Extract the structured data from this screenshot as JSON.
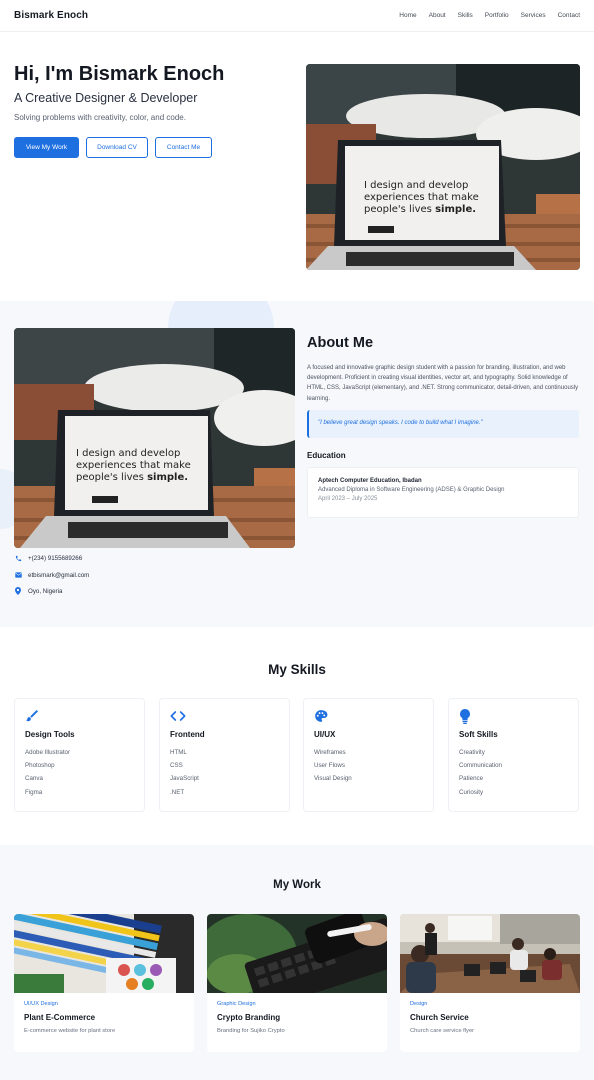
{
  "nav": {
    "brand": "Bismark Enoch",
    "links": [
      "Home",
      "About",
      "Skills",
      "Portfolio",
      "Services",
      "Contact"
    ]
  },
  "hero": {
    "title": "Hi, I'm Bismark Enoch",
    "subtitle": "A Creative Designer & Developer",
    "tagline": "Solving problems with creativity, color, and code.",
    "buttons": [
      "View My Work",
      "Download CV",
      "Contact Me"
    ],
    "laptop_screen_text": "I design and develop experiences that make people's lives",
    "laptop_screen_bold": "simple."
  },
  "about": {
    "title": "About Me",
    "body": "A focused and innovative graphic design student with a passion for branding, illustration, and web development. Proficient in creating visual identities, vector art, and typography. Solid knowledge of HTML, CSS, JavaScript (elementary), and .NET. Strong communicator, detail-driven, and continuously learning.",
    "quote": "\"I believe great design speaks. I code to build what I imagine.\"",
    "education_title": "Education",
    "education": {
      "school": "Aptech Computer Education, Ibadan",
      "program": "Advanced Diploma in Software Engineering (ADSE) & Graphic Design",
      "dates": "April 2023 – July 2025"
    },
    "contacts": [
      {
        "icon": "phone-icon",
        "text": "+(234) 9155689266"
      },
      {
        "icon": "email-icon",
        "text": "etbismark@gmail.com"
      },
      {
        "icon": "location-pin-icon",
        "text": "Oyo, Nigeria"
      }
    ]
  },
  "skills": {
    "title": "My Skills",
    "cards": [
      {
        "icon": "brush-icon",
        "name": "Design Tools",
        "items": [
          "Adobe Illustrator",
          "Photoshop",
          "Canva",
          "Figma"
        ]
      },
      {
        "icon": "code-icon",
        "name": "Frontend",
        "items": [
          "HTML",
          "CSS",
          "JavaScript",
          ".NET"
        ]
      },
      {
        "icon": "palette-icon",
        "name": "UI/UX",
        "items": [
          "Wireframes",
          "User Flows",
          "Visual Design"
        ]
      },
      {
        "icon": "lightbulb-icon",
        "name": "Soft Skills",
        "items": [
          "Creativity",
          "Communication",
          "Patience",
          "Curiosity"
        ]
      }
    ]
  },
  "work": {
    "title": "My Work",
    "projects": [
      {
        "category": "UI/UX Design",
        "name": "Plant E-Commerce",
        "desc": "E-commerce website for plant store"
      },
      {
        "category": "Graphic Design",
        "name": "Crypto Branding",
        "desc": "Branding for Sujiko Crypto"
      },
      {
        "category": "Design",
        "name": "Church Service",
        "desc": "Church care service flyer"
      }
    ]
  },
  "colors": {
    "accent": "#1e6fe0",
    "section_alt_bg": "#f6f8fb"
  }
}
